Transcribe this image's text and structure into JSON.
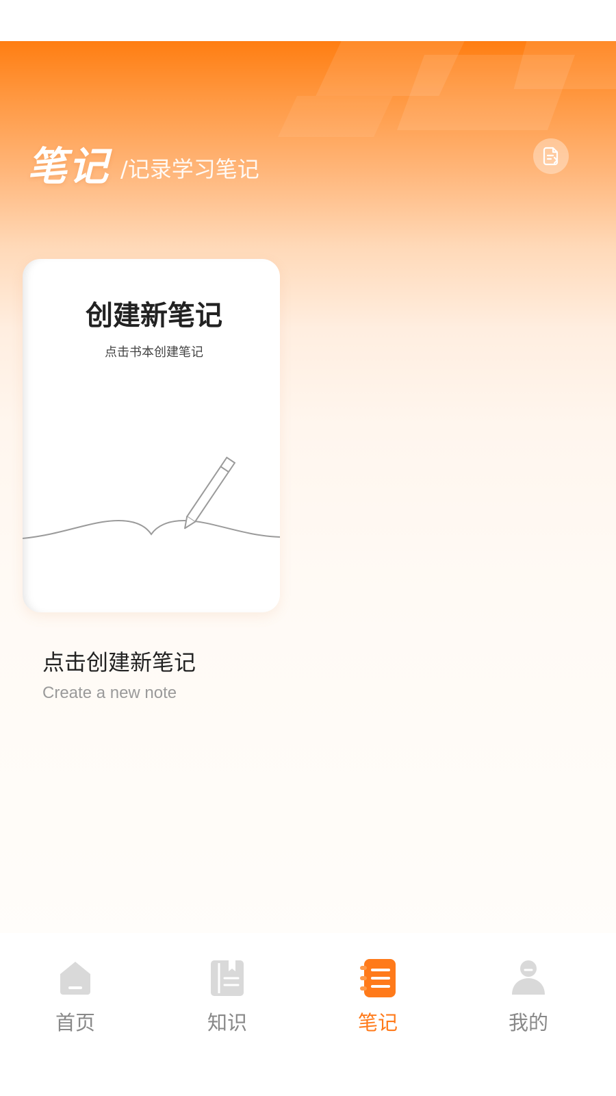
{
  "header": {
    "title": "笔记",
    "subtitle": "/记录学习笔记",
    "action_icon": "note-export-icon"
  },
  "note_card": {
    "title": "创建新笔记",
    "subtitle": "点击书本创建笔记",
    "illustration_icon": "pencil-book-icon"
  },
  "create": {
    "title": "点击创建新笔记",
    "subtitle": "Create a new note"
  },
  "tabs": [
    {
      "label": "首页",
      "icon": "home-icon",
      "active": false
    },
    {
      "label": "知识",
      "icon": "book-icon",
      "active": false
    },
    {
      "label": "笔记",
      "icon": "notebook-icon",
      "active": true
    },
    {
      "label": "我的",
      "icon": "user-icon",
      "active": false
    }
  ],
  "colors": {
    "accent": "#ff7a1a",
    "inactive": "#888888",
    "inactive_icon": "#d9d9d9"
  }
}
